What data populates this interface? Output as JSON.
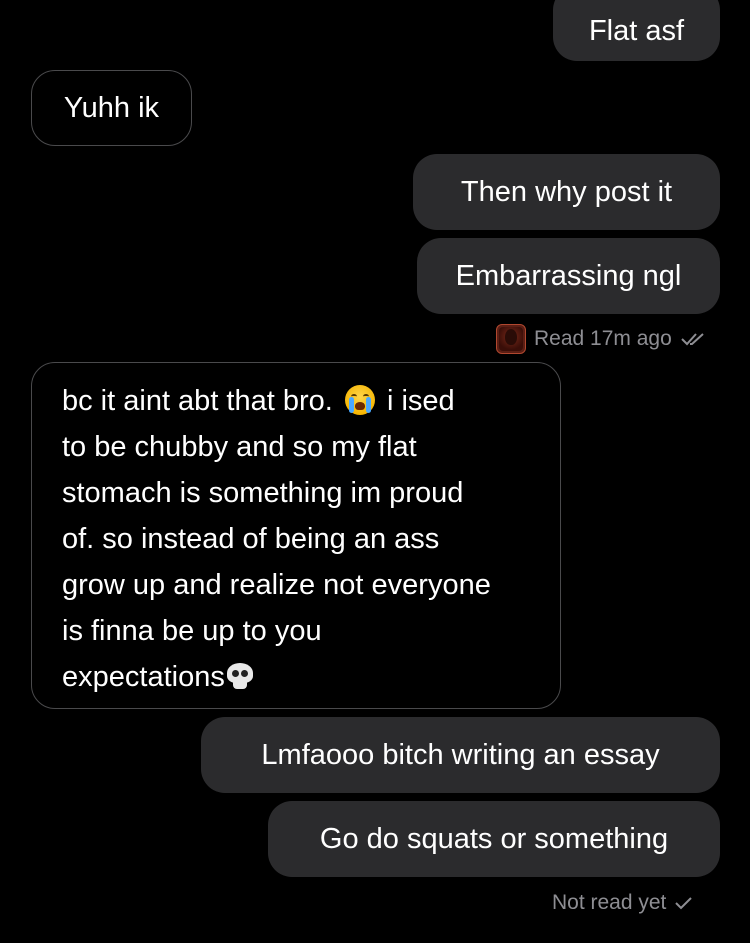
{
  "conversation": {
    "messages": [
      {
        "from": "me",
        "text": "Flat asf"
      },
      {
        "from": "them",
        "text": "Yuhh ik"
      },
      {
        "from": "me",
        "text": "Then why post it"
      },
      {
        "from": "me",
        "text": "Embarrassing ngl"
      },
      {
        "from": "them",
        "lines": [
          "bc it aint abt that bro.",
          "i ised",
          "to be chubby and so my flat",
          "stomach is something im proud",
          "of. so instead of being an ass",
          "grow up and realize not everyone",
          "is finna be up to you",
          "expectations"
        ]
      },
      {
        "from": "me",
        "text": "Lmfaooo bitch writing an essay"
      },
      {
        "from": "me",
        "text": "Go do squats or something"
      }
    ],
    "read_receipt": {
      "text": "Read 17m ago",
      "icon": "double-check-icon"
    },
    "unread_receipt": {
      "text": "Not read yet",
      "icon": "check-icon"
    },
    "emojis": {
      "crying": "loudly-crying-face-icon",
      "skull": "skull-icon"
    }
  }
}
